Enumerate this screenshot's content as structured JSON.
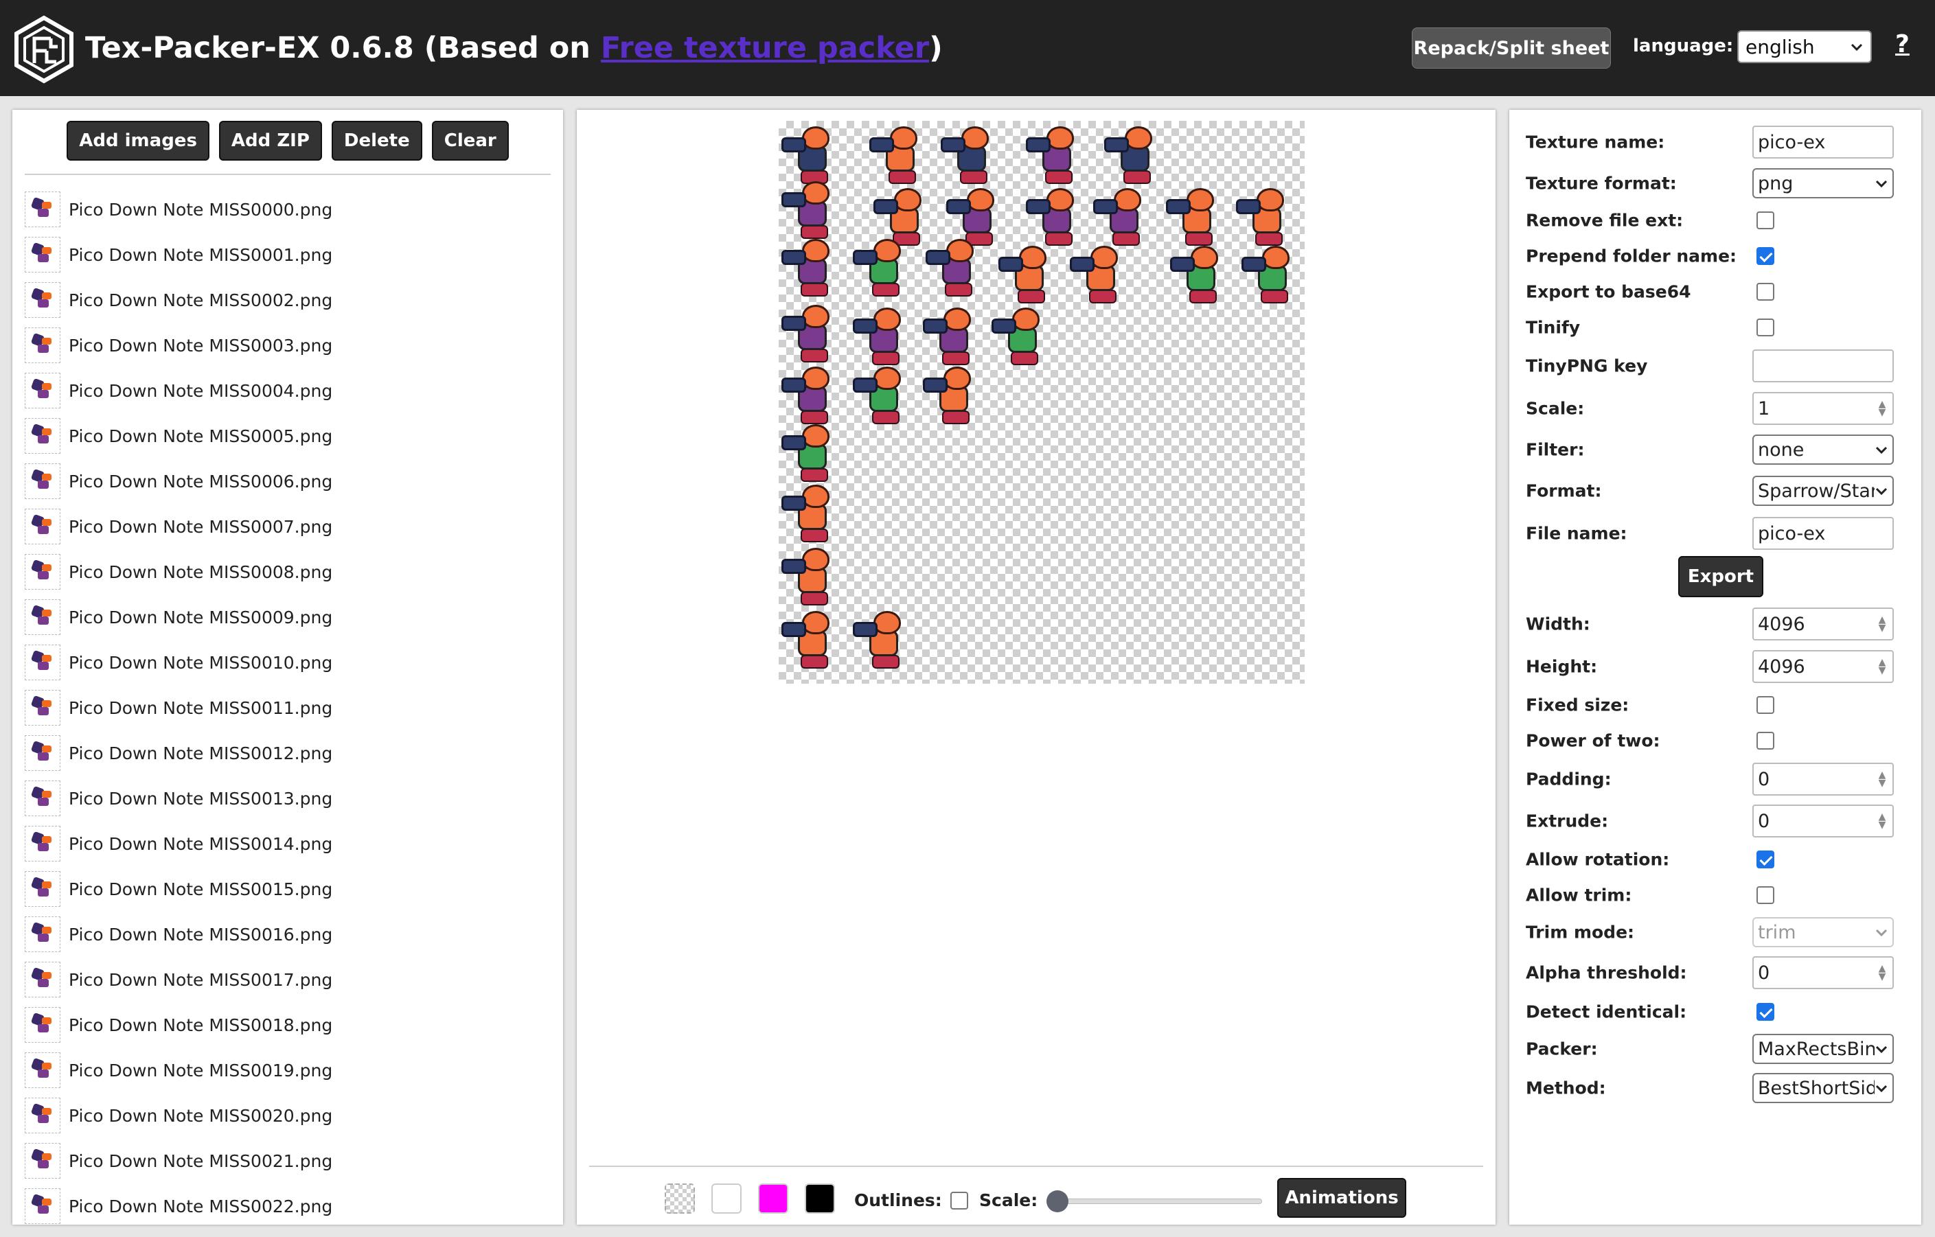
{
  "header": {
    "title_prefix": "Tex-Packer-EX 0.6.8 (Based on ",
    "title_link": "Free texture packer",
    "title_suffix": ")",
    "repack_button": "Repack/Split sheet",
    "language_label": "language:",
    "language_value": "english",
    "help_label": "?"
  },
  "left_panel": {
    "buttons": {
      "add_images": "Add images",
      "add_zip": "Add ZIP",
      "delete": "Delete",
      "clear": "Clear"
    },
    "files": [
      "Pico Down Note MISS0000.png",
      "Pico Down Note MISS0001.png",
      "Pico Down Note MISS0002.png",
      "Pico Down Note MISS0003.png",
      "Pico Down Note MISS0004.png",
      "Pico Down Note MISS0005.png",
      "Pico Down Note MISS0006.png",
      "Pico Down Note MISS0007.png",
      "Pico Down Note MISS0008.png",
      "Pico Down Note MISS0009.png",
      "Pico Down Note MISS0010.png",
      "Pico Down Note MISS0011.png",
      "Pico Down Note MISS0012.png",
      "Pico Down Note MISS0013.png",
      "Pico Down Note MISS0014.png",
      "Pico Down Note MISS0015.png",
      "Pico Down Note MISS0016.png",
      "Pico Down Note MISS0017.png",
      "Pico Down Note MISS0018.png",
      "Pico Down Note MISS0019.png",
      "Pico Down Note MISS0020.png",
      "Pico Down Note MISS0021.png",
      "Pico Down Note MISS0022.png"
    ]
  },
  "center_panel": {
    "sprite_colors": {
      "pink": "#f2703a",
      "purple": "#7a3b8f",
      "green": "#3aa655",
      "navy": "#2f3d6b"
    },
    "bottom": {
      "bg_colors": [
        "transparent",
        "#ffffff",
        "#ff00ff",
        "#000000"
      ],
      "outlines_label": "Outlines:",
      "outlines_checked": false,
      "scale_label": "Scale:",
      "scale_value": 0,
      "animations_button": "Animations"
    }
  },
  "settings": {
    "texture_name_label": "Texture name:",
    "texture_name": "pico-ex",
    "texture_format_label": "Texture format:",
    "texture_format": "png",
    "remove_ext_label": "Remove file ext:",
    "remove_ext": false,
    "prepend_folder_label": "Prepend folder name:",
    "prepend_folder": true,
    "export_base64_label": "Export to base64",
    "export_base64": false,
    "tinify_label": "Tinify",
    "tinify": false,
    "tinypng_key_label": "TinyPNG key",
    "tinypng_key": "",
    "scale_label": "Scale:",
    "scale": "1",
    "filter_label": "Filter:",
    "filter": "none",
    "format_label": "Format:",
    "format": "Sparrow/Starling",
    "file_name_label": "File name:",
    "file_name": "pico-ex",
    "export_button": "Export",
    "width_label": "Width:",
    "width": "4096",
    "height_label": "Height:",
    "height": "4096",
    "fixed_size_label": "Fixed size:",
    "fixed_size": false,
    "power_of_two_label": "Power of two:",
    "power_of_two": false,
    "padding_label": "Padding:",
    "padding": "0",
    "extrude_label": "Extrude:",
    "extrude": "0",
    "allow_rotation_label": "Allow rotation:",
    "allow_rotation": true,
    "allow_trim_label": "Allow trim:",
    "allow_trim": false,
    "trim_mode_label": "Trim mode:",
    "trim_mode": "trim",
    "alpha_threshold_label": "Alpha threshold:",
    "alpha_threshold": "0",
    "detect_identical_label": "Detect identical:",
    "detect_identical": true,
    "packer_label": "Packer:",
    "packer": "MaxRectsBin",
    "method_label": "Method:",
    "method": "BestShortSideFit"
  }
}
